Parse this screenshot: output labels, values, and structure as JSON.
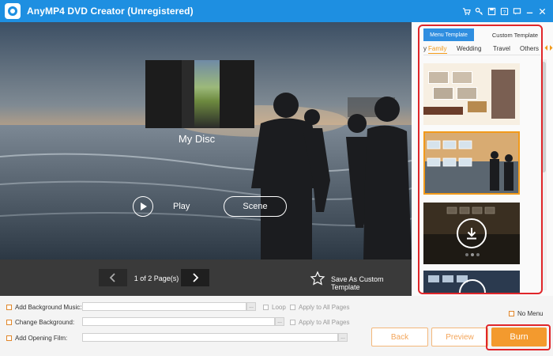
{
  "window": {
    "title": "AnyMP4 DVD Creator (Unregistered)"
  },
  "title_icons": [
    "cart-icon",
    "key-icon",
    "save-icon",
    "help-icon",
    "chat-icon",
    "minimize-icon",
    "close-icon"
  ],
  "preview": {
    "disc_title": "My Disc",
    "play_label": "Play",
    "scene_label": "Scene"
  },
  "pager": {
    "page_text": "1 of 2 Page(s)",
    "save_template_label": "Save As Custom Template"
  },
  "template_panel": {
    "tabs": [
      {
        "label": "Menu Template",
        "active": true
      },
      {
        "label": "Custom Template",
        "active": false
      }
    ],
    "categories": [
      {
        "label": "y",
        "active": false
      },
      {
        "label": "Family",
        "active": true
      },
      {
        "label": "Wedding",
        "active": false
      },
      {
        "label": "Travel",
        "active": false
      },
      {
        "label": "Others",
        "active": false
      }
    ]
  },
  "options": {
    "background_music_label": "Add Background Music:",
    "loop_label": "Loop",
    "apply_all_label_1": "Apply to All Pages",
    "change_background_label": "Change Background:",
    "apply_all_label_2": "Apply to All Pages",
    "opening_film_label": "Add Opening Film:",
    "browse_label": "...",
    "no_menu_label": "No Menu"
  },
  "actions": {
    "back_label": "Back",
    "preview_label": "Preview",
    "burn_label": "Burn"
  },
  "colors": {
    "titlebar": "#1e8fe1",
    "accent_orange": "#f39a2e",
    "highlight_red": "#e0262a",
    "tab_blue": "#2f8ee0"
  }
}
